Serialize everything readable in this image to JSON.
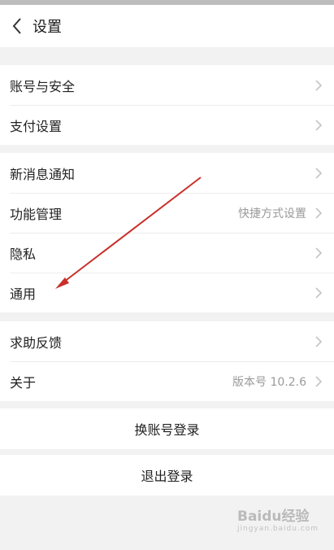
{
  "header": {
    "title": "设置"
  },
  "groups": [
    {
      "items": [
        {
          "label": "账号与安全",
          "value": ""
        },
        {
          "label": "支付设置",
          "value": ""
        }
      ]
    },
    {
      "items": [
        {
          "label": "新消息通知",
          "value": ""
        },
        {
          "label": "功能管理",
          "value": "快捷方式设置"
        },
        {
          "label": "隐私",
          "value": ""
        },
        {
          "label": "通用",
          "value": ""
        }
      ]
    },
    {
      "items": [
        {
          "label": "求助反馈",
          "value": ""
        },
        {
          "label": "关于",
          "value": "版本号 10.2.6"
        }
      ]
    }
  ],
  "buttons": {
    "switch_account": "换账号登录",
    "logout": "退出登录"
  },
  "watermark": {
    "brand": "Baidu经验",
    "url": "jingyan.baidu.com"
  },
  "icons": {
    "back": "back-chevron-icon",
    "row_chevron": "chevron-right-icon",
    "annotation": "red-arrow-icon"
  },
  "colors": {
    "annotation_arrow": "#c9302c"
  }
}
